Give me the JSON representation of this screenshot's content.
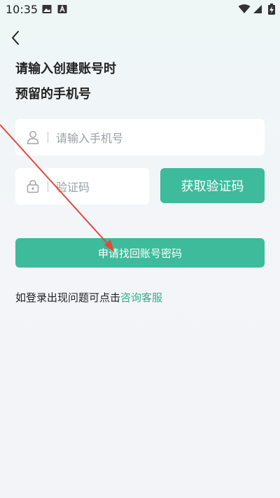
{
  "status_bar": {
    "time": "10:35"
  },
  "page": {
    "title_line1": "请输入创建账号时",
    "title_line2": "预留的手机号"
  },
  "form": {
    "phone_placeholder": "请输入手机号",
    "code_placeholder": "验证码",
    "get_code_label": "获取验证码",
    "submit_label": "申请找回账号密码"
  },
  "help": {
    "prefix": "如登录出现问题可点击",
    "link": "咨询客服"
  },
  "colors": {
    "accent": "#3dbb9b",
    "link": "#2fae8e",
    "annotation_arrow": "#e04a3f"
  },
  "icons": [
    "image-icon",
    "text-icon",
    "wifi-icon",
    "signal-icon",
    "battery-charging-icon",
    "back-arrow-icon",
    "user-icon",
    "lock-icon"
  ]
}
